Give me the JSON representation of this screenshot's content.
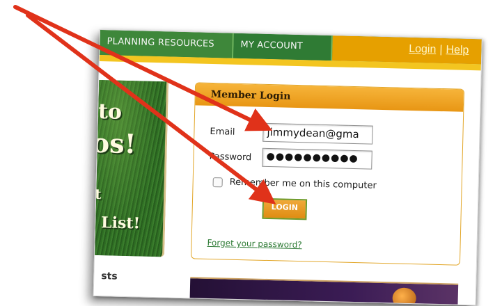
{
  "nav": {
    "tab1": "PLANNING RESOURCES",
    "tab2": "MY ACCOUNT",
    "login_link": "Login",
    "separator": "|",
    "help_link": "Help"
  },
  "promo": {
    "line1": "to",
    "line2": "os!",
    "line3": "t",
    "line4": "List!"
  },
  "left_partial_text": "sts",
  "login": {
    "title": "Member Login",
    "email_label": "Email",
    "email_value": "jimmydean@gma",
    "password_label": "Password",
    "password_value": "●●●●●●●●●●",
    "remember_label": "Remember me on this computer",
    "button_label": "LOGIN",
    "forgot_link": "Forget your password?"
  },
  "colors": {
    "nav_green": "#3f8a3a",
    "accent_orange": "#e6a000",
    "arrow_red": "#e0321a"
  }
}
